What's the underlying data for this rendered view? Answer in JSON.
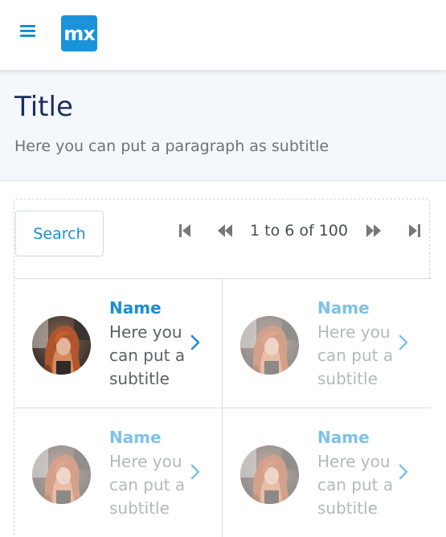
{
  "topbar": {
    "menu_icon": "hamburger-menu-icon",
    "logo_text": "mx",
    "brand_color": "#1b93da"
  },
  "header": {
    "title": "Title",
    "subtitle": "Here you can put a paragraph as subtitle"
  },
  "toolbar": {
    "search_label": "Search"
  },
  "pager": {
    "first_icon": "first-page-icon",
    "prev_icon": "previous-page-icon",
    "status": "1 to 6 of 100",
    "next_icon": "next-page-icon",
    "last_icon": "last-page-icon"
  },
  "items": [
    {
      "name": "Name",
      "subtitle": "Here you can put a subtitle",
      "icon": "chevron-right-icon"
    },
    {
      "name": "Name",
      "subtitle": "Here you can put a subtitle",
      "icon": "chevron-right-icon"
    },
    {
      "name": "Name",
      "subtitle": "Here you can put a subtitle",
      "icon": "chevron-right-icon"
    },
    {
      "name": "Name",
      "subtitle": "Here you can put a subtitle",
      "icon": "chevron-right-icon"
    }
  ],
  "colors": {
    "accent": "#1b8ed2",
    "header_bg": "#f4f7fc",
    "title": "#1c2e5c"
  }
}
